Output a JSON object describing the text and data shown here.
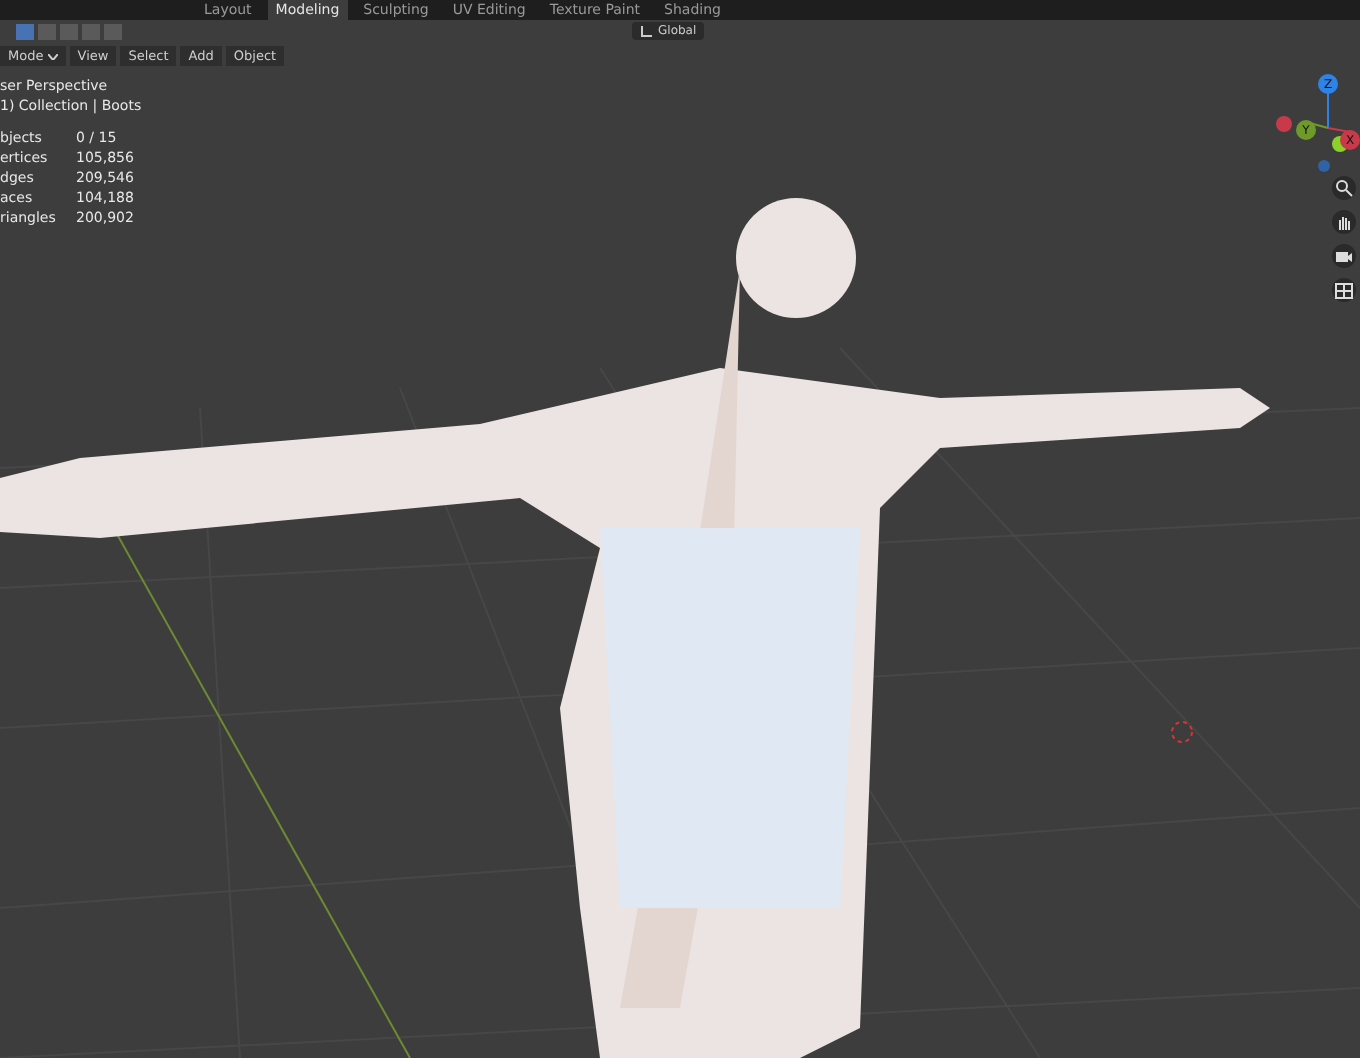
{
  "workspace_tabs": [
    {
      "label": "Layout",
      "selected": false
    },
    {
      "label": "Modeling",
      "selected": true
    },
    {
      "label": "Sculpting",
      "selected": false
    },
    {
      "label": "UV Editing",
      "selected": false
    },
    {
      "label": "Texture Paint",
      "selected": false
    },
    {
      "label": "Shading",
      "selected": false
    }
  ],
  "tool_header": {
    "select_modes": [
      {
        "selected": true
      },
      {
        "selected": false
      },
      {
        "selected": false
      },
      {
        "selected": false
      },
      {
        "selected": false
      }
    ],
    "orientation": "Global"
  },
  "view_header": {
    "mode": "Mode",
    "menus": [
      "View",
      "Select",
      "Add",
      "Object"
    ]
  },
  "overlay": {
    "view_name": "ser Perspective",
    "collection": "1) Collection | Boots",
    "stats": [
      {
        "label": "bjects",
        "value": "0 / 15"
      },
      {
        "label": "ertices",
        "value": "105,856"
      },
      {
        "label": "dges",
        "value": "209,546"
      },
      {
        "label": "aces",
        "value": "104,188"
      },
      {
        "label": "riangles",
        "value": "200,902"
      }
    ]
  },
  "gizmo_axes": [
    {
      "label": "Z",
      "color": "#2f83e6"
    },
    {
      "label": "Y",
      "color": "#6e9a2c"
    },
    {
      "label": "X",
      "color": "#c83a4a"
    }
  ]
}
